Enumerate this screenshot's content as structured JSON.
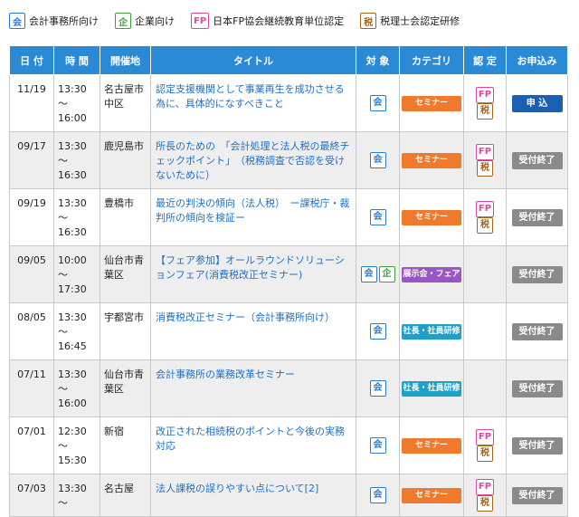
{
  "legend": [
    {
      "icon": "会",
      "label": "会計事務所向け",
      "kind": "kai"
    },
    {
      "icon": "企",
      "label": "企業向け",
      "kind": "ki"
    },
    {
      "icon": "FP",
      "label": "日本FP協会継続教育単位認定",
      "kind": "fp"
    },
    {
      "icon": "税",
      "label": "税理士会認定研修",
      "kind": "zei"
    }
  ],
  "headers": {
    "date": "日 付",
    "time": "時 間",
    "venue": "開催地",
    "title": "タイトル",
    "target": "対 象",
    "category": "カテゴリ",
    "cert": "認 定",
    "apply": "お申込み"
  },
  "colors": {
    "header_bg": "#2a8ad5",
    "seminar": "#f07a2c",
    "expo": "#9a56c8",
    "staff": "#1fa0c9",
    "apply": "#1a5fb4",
    "closed": "#8a8a8a"
  },
  "rows": [
    {
      "date": "11/19",
      "time": "13:30～\n16:00",
      "venue": "名古屋市\n中区",
      "title": "認定支援機関として事業再生を成功させる為に、具体的になすべきこと",
      "targets": [
        "会"
      ],
      "category": "セミナー",
      "cat": "seminar",
      "certs": [
        "FP",
        "税"
      ],
      "apply": "申 込",
      "status": "apply"
    },
    {
      "date": "09/17",
      "time": "13:30～\n16:30",
      "venue": "鹿児島市",
      "title": "所長のための　「会計処理と法人税の最終チェックポイント」　（税務調査で否認を受けないために）",
      "targets": [
        "会"
      ],
      "category": "セミナー",
      "cat": "seminar",
      "certs": [
        "FP",
        "税"
      ],
      "apply": "受付終了",
      "status": "closed"
    },
    {
      "date": "09/19",
      "time": "13:30～\n16:30",
      "venue": "豊橋市",
      "title": "最近の判決の傾向（法人税）　ー課税庁・裁判所の傾向を検証ー",
      "targets": [
        "会"
      ],
      "category": "セミナー",
      "cat": "seminar",
      "certs": [
        "FP",
        "税"
      ],
      "apply": "受付終了",
      "status": "closed"
    },
    {
      "date": "09/05",
      "time": "10:00～\n17:30",
      "venue": "仙台市青\n葉区",
      "title": "【フェア参加】オールラウンドソリューションフェア(消費税改正セミナー)",
      "targets": [
        "会",
        "企"
      ],
      "category": "展示会・フェア",
      "cat": "expo",
      "certs": [],
      "apply": "受付終了",
      "status": "closed"
    },
    {
      "date": "08/05",
      "time": "13:30～\n16:45",
      "venue": "宇都宮市",
      "title": "消費税改正セミナー（会計事務所向け）",
      "targets": [
        "会"
      ],
      "category": "社長・社員研修",
      "cat": "staff",
      "certs": [],
      "apply": "受付終了",
      "status": "closed"
    },
    {
      "date": "07/11",
      "time": "13:30～\n16:00",
      "venue": "仙台市青\n葉区",
      "title": "会計事務所の業務改革セミナー",
      "targets": [
        "会"
      ],
      "category": "社長・社員研修",
      "cat": "staff",
      "certs": [],
      "apply": "受付終了",
      "status": "closed"
    },
    {
      "date": "07/01",
      "time": "12:30～\n15:30",
      "venue": "新宿",
      "title": "改正された相続税のポイントと今後の実務対応",
      "targets": [
        "会"
      ],
      "category": "セミナー",
      "cat": "seminar",
      "certs": [
        "FP",
        "税"
      ],
      "apply": "受付終了",
      "status": "closed"
    },
    {
      "date": "07/03",
      "time": "13:30～",
      "venue": "名古屋",
      "title": "法人課税の誤りやすい点について[2]",
      "targets": [
        "会"
      ],
      "category": "セミナー",
      "cat": "seminar",
      "certs": [
        "FP",
        "税"
      ],
      "apply": "受付終了",
      "status": "closed"
    }
  ]
}
